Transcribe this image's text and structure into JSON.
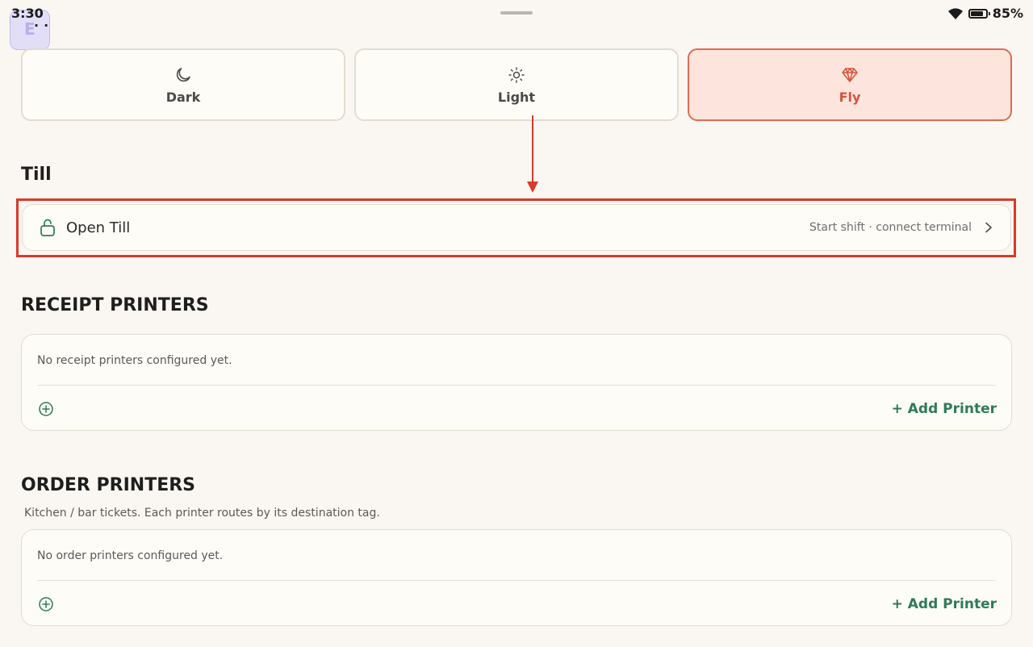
{
  "status_bar": {
    "time": "3:30",
    "app_letter": "E",
    "app_dots": "··",
    "battery": "85%",
    "battery_level": 0.85
  },
  "themes": [
    {
      "label": "Dark",
      "icon": "moon-icon",
      "active": false
    },
    {
      "label": "Light",
      "icon": "sun-icon",
      "active": false
    },
    {
      "label": "Fly",
      "icon": "diamond-icon",
      "active": true
    }
  ],
  "colors": {
    "accent": "#e16a52",
    "accent_bg": "#fde5de",
    "green": "#2f7a5a",
    "annotation": "#d93a2a"
  },
  "till": {
    "section_title": "Till",
    "row_title": "Open Till",
    "row_meta": "Start shift · connect terminal"
  },
  "receipt_printers": {
    "section_title": "RECEIPT PRINTERS",
    "empty_text": "No receipt printers configured yet.",
    "add_label": "+ Add Printer"
  },
  "order_printers": {
    "section_title": "ORDER PRINTERS",
    "subtitle": "Kitchen / bar tickets. Each printer routes by its destination tag.",
    "empty_text": "No order printers configured yet.",
    "add_label": "+ Add Printer"
  }
}
